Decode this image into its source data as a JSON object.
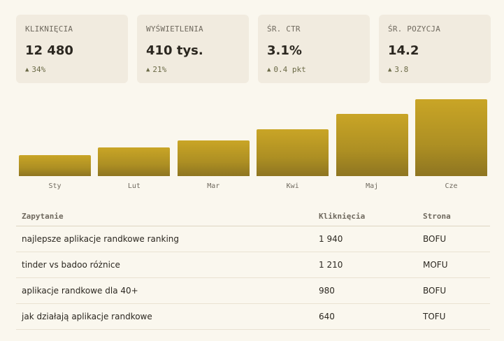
{
  "kpis": [
    {
      "label": "KLIKNIĘCIA",
      "value": "12 480",
      "delta": "34%"
    },
    {
      "label": "WYŚWIETLENIA",
      "value": "410 tys.",
      "delta": "21%"
    },
    {
      "label": "ŚR. CTR",
      "value": "3.1%",
      "delta": "0.4 pkt"
    },
    {
      "label": "ŚR. POZYCJA",
      "value": "14.2",
      "delta": "3.8"
    }
  ],
  "delta_icon": "triangle-up-icon",
  "chart_data": {
    "type": "bar",
    "categories": [
      "Sty",
      "Lut",
      "Mar",
      "Kwi",
      "Maj",
      "Cze"
    ],
    "values": [
      27,
      37,
      46,
      61,
      81,
      100
    ],
    "ylim": [
      0,
      100
    ],
    "grid": false,
    "title": "",
    "xlabel": "",
    "ylabel": "",
    "bar_color_top": "#c9a526",
    "bar_color_bottom": "#8e7521"
  },
  "table": {
    "headers": [
      "Zapytanie",
      "Kliknięcia",
      "Strona"
    ],
    "rows": [
      [
        "najlepsze aplikacje randkowe ranking",
        "1 940",
        "BOFU"
      ],
      [
        "tinder vs badoo różnice",
        "1 210",
        "MOFU"
      ],
      [
        "aplikacje randkowe dla 40+",
        "980",
        "BOFU"
      ],
      [
        "jak działają aplikacje randkowe",
        "640",
        "TOFU"
      ]
    ]
  },
  "colors": {
    "background": "#faf7ee",
    "card": "#f1ebdf",
    "accent": "#c9a526",
    "delta": "#6b6a47"
  }
}
